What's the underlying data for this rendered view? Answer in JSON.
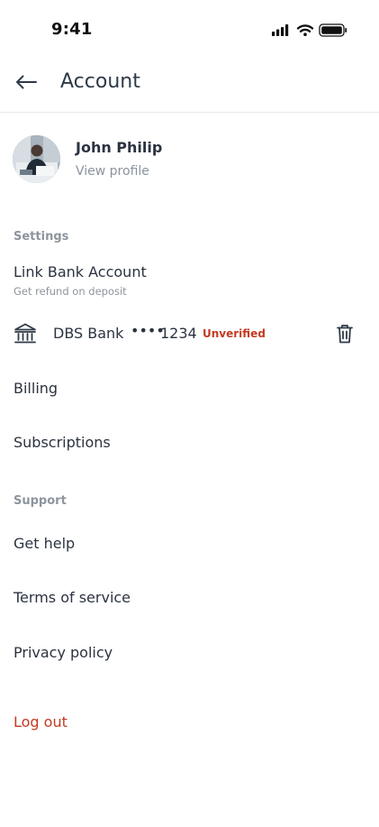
{
  "status_bar": {
    "time": "9:41"
  },
  "header": {
    "title": "Account"
  },
  "profile": {
    "name": "John Philip",
    "link_label": "View profile"
  },
  "settings": {
    "label": "Settings",
    "link_bank": {
      "title": "Link Bank Account",
      "subtitle": "Get refund on deposit"
    },
    "bank": {
      "name": "DBS Bank",
      "mask": "••••",
      "last4": "1234",
      "status": "Unverified",
      "status_color": "#c43a21"
    },
    "billing": "Billing",
    "subscriptions": "Subscriptions"
  },
  "support": {
    "label": "Support",
    "get_help": "Get help",
    "terms": "Terms of service",
    "privacy": "Privacy policy"
  },
  "logout_label": "Log out",
  "icons": [
    "back-arrow-icon",
    "bank-icon",
    "trash-icon",
    "signal-icon",
    "wifi-icon",
    "battery-icon"
  ]
}
